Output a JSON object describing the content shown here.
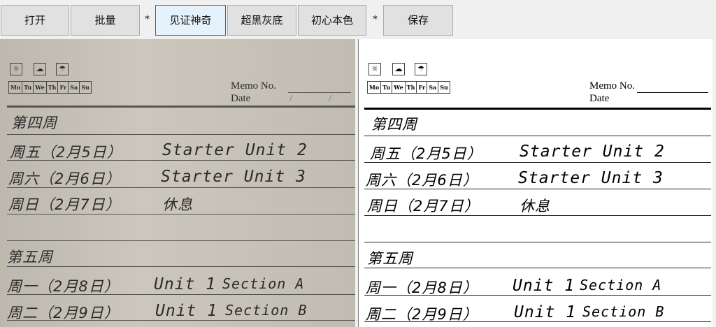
{
  "toolbar": {
    "open": "打开",
    "batch": "批量",
    "sep1": "*",
    "witness": "见证神奇",
    "ultra_black_gray": "超黑灰底",
    "original_color": "初心本色",
    "sep2": "*",
    "save": "保存"
  },
  "memo": {
    "days": [
      "Mo",
      "Tu",
      "We",
      "Th",
      "Fr",
      "Sa",
      "Su"
    ],
    "memo_no_label": "Memo No.",
    "date_label": "Date",
    "date_slash": "/"
  },
  "entries": {
    "week4_heading": "第四周",
    "fri_date": "周五（2月5日）",
    "fri_task": "Starter Unit 2",
    "sat_date": "周六（2月6日）",
    "sat_task": "Starter Unit 3",
    "sun_date": "周日（2月7日）",
    "sun_task": "休息",
    "week5_heading": "第五周",
    "mon_date": "周一（2月8日）",
    "mon_task": "Unit 1",
    "mon_section": "Section A",
    "tue_date": "周二（2月9日）",
    "tue_task": "Unit 1",
    "tue_section": "Section B"
  },
  "icons": [
    "sun-icon",
    "cloud-icon",
    "rain-icon"
  ],
  "colors": {
    "toolbar_bg": "#f0f0f0",
    "button_bg": "#e1e1e1",
    "focus_border": "#0078d7",
    "original_paper": "#c9c4b9",
    "processed_paper": "#ffffff"
  }
}
